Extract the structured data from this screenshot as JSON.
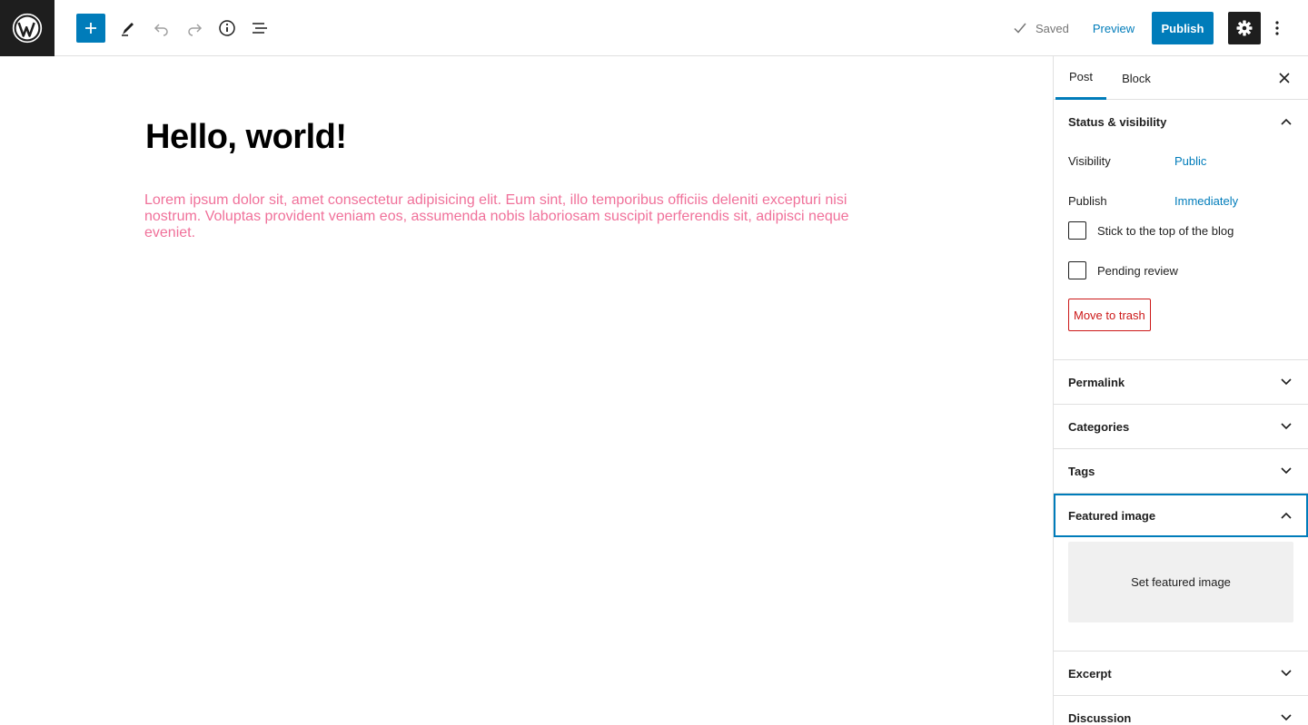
{
  "header": {
    "saved_label": "Saved",
    "preview_label": "Preview",
    "publish_label": "Publish"
  },
  "post": {
    "title": "Hello, world!",
    "paragraph": "Lorem ipsum dolor sit, amet consectetur adipisicing elit. Eum sint, illo temporibus officiis deleniti excepturi nisi nostrum. Voluptas provident veniam eos, assumenda nobis laboriosam suscipit perferendis sit, adipisci neque eveniet."
  },
  "sidebar": {
    "tabs": {
      "post": "Post",
      "block": "Block"
    },
    "status": {
      "title": "Status & visibility",
      "visibility_label": "Visibility",
      "visibility_value": "Public",
      "publish_label": "Publish",
      "publish_value": "Immediately",
      "stick_label": "Stick to the top of the blog",
      "pending_label": "Pending review",
      "trash_label": "Move to trash"
    },
    "panels": {
      "permalink": "Permalink",
      "categories": "Categories",
      "tags": "Tags",
      "featured_image": "Featured image",
      "set_featured_image": "Set featured image",
      "excerpt": "Excerpt",
      "discussion": "Discussion"
    }
  },
  "colors": {
    "accent": "#007cba",
    "paragraph_text": "#f0719a",
    "danger": "#cc1818",
    "dark": "#1e1e1e"
  }
}
